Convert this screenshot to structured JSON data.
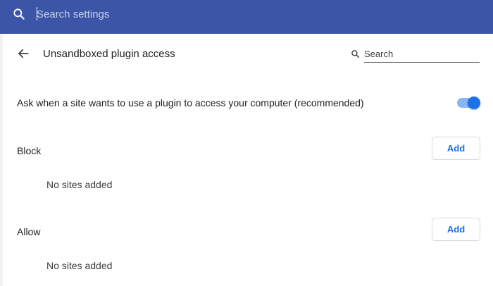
{
  "header": {
    "search_placeholder": "Search settings"
  },
  "page": {
    "title": "Unsandboxed plugin access",
    "search_placeholder": "Search"
  },
  "setting": {
    "label": "Ask when a site wants to use a plugin to access your computer (recommended)",
    "enabled": true
  },
  "sections": {
    "block": {
      "label": "Block",
      "add_label": "Add",
      "empty_text": "No sites added"
    },
    "allow": {
      "label": "Allow",
      "add_label": "Add",
      "empty_text": "No sites added"
    }
  },
  "colors": {
    "header_bg": "#3c55a7",
    "accent": "#1a73e8",
    "toggle_track": "#8ab4f8"
  },
  "icons": {
    "header_search": "search-icon",
    "back": "back-arrow-icon",
    "page_search": "search-icon"
  }
}
